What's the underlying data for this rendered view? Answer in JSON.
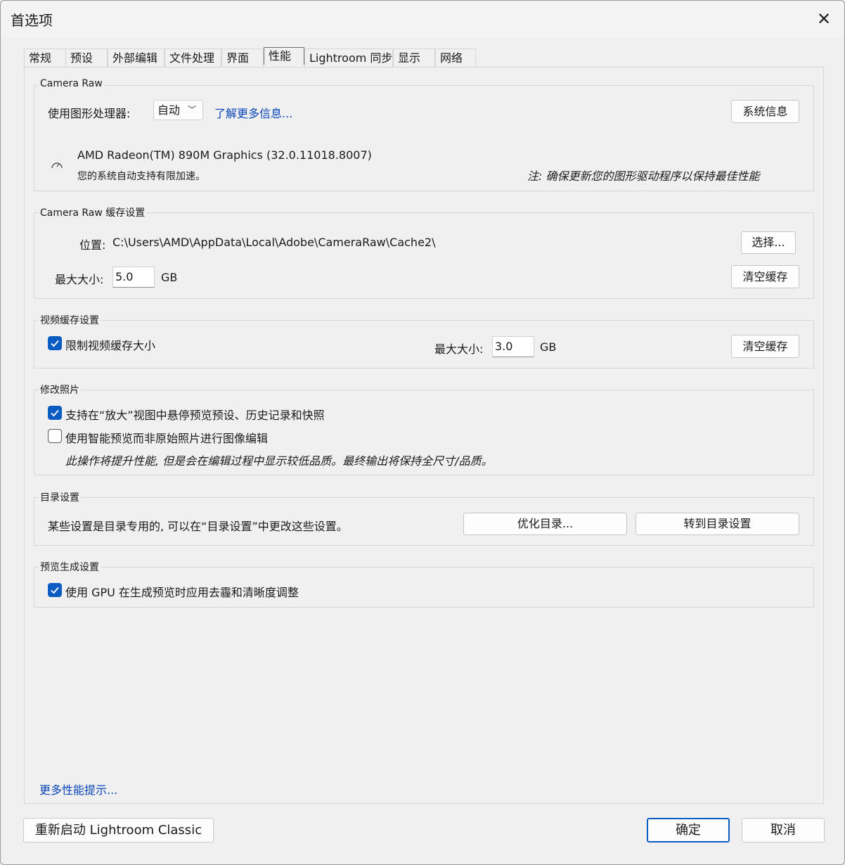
{
  "window": {
    "title": "首选项"
  },
  "tabs": [
    {
      "label": "常规"
    },
    {
      "label": "预设"
    },
    {
      "label": "外部编辑"
    },
    {
      "label": "文件处理"
    },
    {
      "label": "界面"
    },
    {
      "label": "性能"
    },
    {
      "label": "Lightroom 同步"
    },
    {
      "label": "显示"
    },
    {
      "label": "网络"
    }
  ],
  "active_tab": "性能",
  "camera_raw": {
    "legend": "Camera Raw",
    "gpu_label": "使用图形处理器:",
    "gpu_value": "自动",
    "learn_more": "了解更多信息...",
    "system_info_button": "系统信息",
    "gpu_name": "AMD Radeon(TM) 890M Graphics (32.0.11018.8007)",
    "gpu_status": "您的系统自动支持有限加速。",
    "note": "注: 确保更新您的图形驱动程序以保持最佳性能"
  },
  "cache": {
    "legend": "Camera Raw 缓存设置",
    "location_label": "位置:",
    "location_value": "C:\\Users\\AMD\\AppData\\Local\\Adobe\\CameraRaw\\Cache2\\",
    "choose_button": "选择...",
    "max_size_label": "最大大小:",
    "max_size_value": "5.0",
    "unit": "GB",
    "clear_button": "清空缓存"
  },
  "video_cache": {
    "legend": "视频缓存设置",
    "limit_label": "限制视频缓存大小",
    "limit_checked": true,
    "max_size_label": "最大大小:",
    "max_size_value": "3.0",
    "unit": "GB",
    "clear_button": "清空缓存"
  },
  "develop": {
    "legend": "修改照片",
    "option1": "支持在“放大”视图中悬停预览预设、历史记录和快照",
    "option1_checked": true,
    "option2": "使用智能预览而非原始照片进行图像编辑",
    "option2_checked": false,
    "note": "此操作将提升性能, 但是会在编辑过程中显示较低品质。最终输出将保持全尺寸/品质。"
  },
  "catalog": {
    "legend": "目录设置",
    "text": "某些设置是目录专用的, 可以在“目录设置”中更改这些设置。",
    "optimize_button": "优化目录...",
    "goto_button": "转到目录设置"
  },
  "preview": {
    "legend": "预览生成设置",
    "option": "使用 GPU 在生成预览时应用去霾和清晰度调整",
    "option_checked": true
  },
  "more_tips": "更多性能提示...",
  "footer": {
    "restart_button": "重新启动 Lightroom Classic",
    "ok_button": "确定",
    "cancel_button": "取消"
  }
}
